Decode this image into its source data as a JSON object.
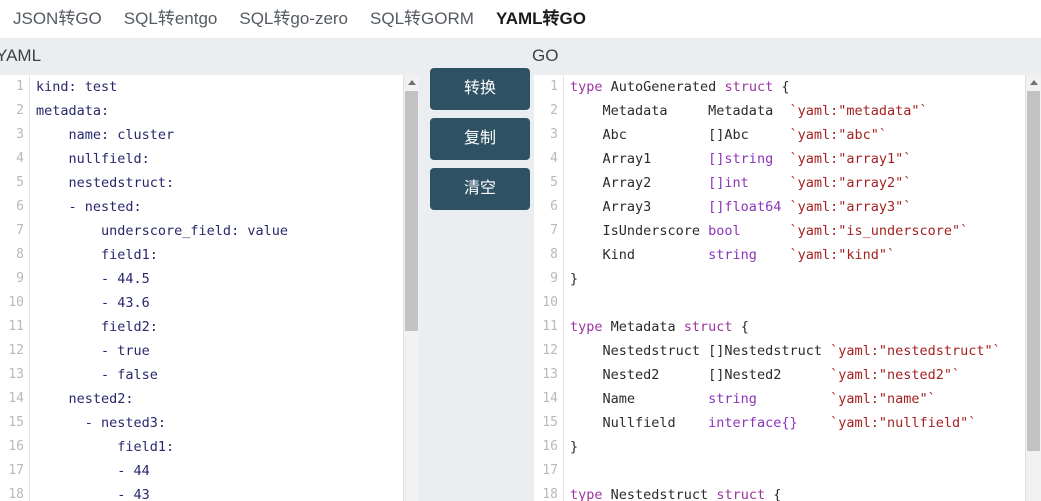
{
  "tabs": [
    {
      "label": "JSON转GO",
      "active": false
    },
    {
      "label": "SQL转entgo",
      "active": false
    },
    {
      "label": "SQL转go-zero",
      "active": false
    },
    {
      "label": "SQL转GORM",
      "active": false
    },
    {
      "label": "YAML转GO",
      "active": true
    }
  ],
  "panels": {
    "left_label": "YAML",
    "right_label": "GO"
  },
  "buttons": {
    "convert": "转换",
    "copy": "复制",
    "clear": "清空"
  },
  "colors": {
    "button_bg": "#2e5263",
    "panel_bg": "#eaeef0",
    "editor_bg": "#ffffff",
    "yaml_text": "#27286b",
    "go_keyword": "#9b35a0",
    "go_type": "#8b35bb",
    "go_tag": "#a52121",
    "linenum": "#b9b9b9"
  },
  "yaml_editor": {
    "lines": [
      {
        "n": "1",
        "text": "kind: test"
      },
      {
        "n": "2",
        "text": "metadata:"
      },
      {
        "n": "3",
        "text": "    name: cluster"
      },
      {
        "n": "4",
        "text": "    nullfield:"
      },
      {
        "n": "5",
        "text": "    nestedstruct:"
      },
      {
        "n": "6",
        "text": "    - nested:"
      },
      {
        "n": "7",
        "text": "        underscore_field: value"
      },
      {
        "n": "8",
        "text": "        field1:"
      },
      {
        "n": "9",
        "text": "        - 44.5"
      },
      {
        "n": "10",
        "text": "        - 43.6"
      },
      {
        "n": "11",
        "text": "        field2:"
      },
      {
        "n": "12",
        "text": "        - true"
      },
      {
        "n": "13",
        "text": "        - false"
      },
      {
        "n": "14",
        "text": "    nested2:"
      },
      {
        "n": "15",
        "text": "      - nested3:"
      },
      {
        "n": "16",
        "text": "          field1:"
      },
      {
        "n": "17",
        "text": "          - 44"
      },
      {
        "n": "18",
        "text": "          - 43"
      }
    ]
  },
  "go_editor": {
    "lines": [
      {
        "n": "1",
        "segs": [
          {
            "t": "type ",
            "c": "c-kw"
          },
          {
            "t": "AutoGenerated ",
            "c": "c-ident"
          },
          {
            "t": "struct ",
            "c": "c-kw"
          },
          {
            "t": "{",
            "c": "c-plain"
          }
        ]
      },
      {
        "n": "2",
        "segs": [
          {
            "t": "    Metadata     ",
            "c": "c-ident"
          },
          {
            "t": "Metadata  ",
            "c": "c-ident"
          },
          {
            "t": "`yaml:\"metadata\"`",
            "c": "c-tag"
          }
        ]
      },
      {
        "n": "3",
        "segs": [
          {
            "t": "    Abc          ",
            "c": "c-ident"
          },
          {
            "t": "[]Abc     ",
            "c": "c-ident"
          },
          {
            "t": "`yaml:\"abc\"`",
            "c": "c-tag"
          }
        ]
      },
      {
        "n": "4",
        "segs": [
          {
            "t": "    Array1       ",
            "c": "c-ident"
          },
          {
            "t": "[]string  ",
            "c": "c-type"
          },
          {
            "t": "`yaml:\"array1\"`",
            "c": "c-tag"
          }
        ]
      },
      {
        "n": "5",
        "segs": [
          {
            "t": "    Array2       ",
            "c": "c-ident"
          },
          {
            "t": "[]int     ",
            "c": "c-type"
          },
          {
            "t": "`yaml:\"array2\"`",
            "c": "c-tag"
          }
        ]
      },
      {
        "n": "6",
        "segs": [
          {
            "t": "    Array3       ",
            "c": "c-ident"
          },
          {
            "t": "[]float64 ",
            "c": "c-type"
          },
          {
            "t": "`yaml:\"array3\"`",
            "c": "c-tag"
          }
        ]
      },
      {
        "n": "7",
        "segs": [
          {
            "t": "    IsUnderscore ",
            "c": "c-ident"
          },
          {
            "t": "bool      ",
            "c": "c-type"
          },
          {
            "t": "`yaml:\"is_underscore\"`",
            "c": "c-tag"
          }
        ]
      },
      {
        "n": "8",
        "segs": [
          {
            "t": "    Kind         ",
            "c": "c-ident"
          },
          {
            "t": "string    ",
            "c": "c-type"
          },
          {
            "t": "`yaml:\"kind\"`",
            "c": "c-tag"
          }
        ]
      },
      {
        "n": "9",
        "segs": [
          {
            "t": "}",
            "c": "c-plain"
          }
        ]
      },
      {
        "n": "10",
        "segs": [
          {
            "t": "",
            "c": "c-plain"
          }
        ]
      },
      {
        "n": "11",
        "segs": [
          {
            "t": "type ",
            "c": "c-kw"
          },
          {
            "t": "Metadata ",
            "c": "c-ident"
          },
          {
            "t": "struct ",
            "c": "c-kw"
          },
          {
            "t": "{",
            "c": "c-plain"
          }
        ]
      },
      {
        "n": "12",
        "segs": [
          {
            "t": "    Nestedstruct ",
            "c": "c-ident"
          },
          {
            "t": "[]Nestedstruct ",
            "c": "c-ident"
          },
          {
            "t": "`yaml:\"nestedstruct\"`",
            "c": "c-tag"
          }
        ]
      },
      {
        "n": "13",
        "segs": [
          {
            "t": "    Nested2      ",
            "c": "c-ident"
          },
          {
            "t": "[]Nested2      ",
            "c": "c-ident"
          },
          {
            "t": "`yaml:\"nested2\"`",
            "c": "c-tag"
          }
        ]
      },
      {
        "n": "14",
        "segs": [
          {
            "t": "    Name         ",
            "c": "c-ident"
          },
          {
            "t": "string         ",
            "c": "c-type"
          },
          {
            "t": "`yaml:\"name\"`",
            "c": "c-tag"
          }
        ]
      },
      {
        "n": "15",
        "segs": [
          {
            "t": "    Nullfield    ",
            "c": "c-ident"
          },
          {
            "t": "interface{}    ",
            "c": "c-type"
          },
          {
            "t": "`yaml:\"nullfield\"`",
            "c": "c-tag"
          }
        ]
      },
      {
        "n": "16",
        "segs": [
          {
            "t": "}",
            "c": "c-plain"
          }
        ]
      },
      {
        "n": "17",
        "segs": [
          {
            "t": "",
            "c": "c-plain"
          }
        ]
      },
      {
        "n": "18",
        "segs": [
          {
            "t": "type ",
            "c": "c-kw"
          },
          {
            "t": "Nestedstruct ",
            "c": "c-ident"
          },
          {
            "t": "struct ",
            "c": "c-kw"
          },
          {
            "t": "{",
            "c": "c-plain"
          }
        ]
      }
    ]
  },
  "scrollbars": {
    "yaml_arrow": "scroll-up-arrow",
    "go_arrow": "scroll-up-arrow"
  }
}
